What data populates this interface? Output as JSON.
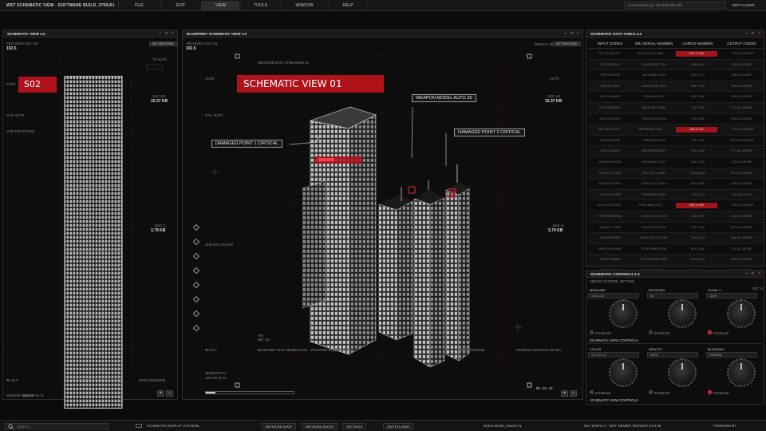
{
  "app": {
    "title": "WST SCHEMATIC VIEW - SOFTWARE BUILD_3765/A1",
    "menu": [
      "FILE",
      "EDIT",
      "VIEW",
      "TOOLS",
      "WINDOW",
      "HELP"
    ],
    "active_menu": "VIEW",
    "ip_field": "Connected to Ip: 192.168.100.225",
    "user": "WST 5 USER"
  },
  "left_panel": {
    "title": "SCHEMATIC VIEW 2.0",
    "archive_label": "ARCHIVED LOG 101",
    "archive_value": "102.5",
    "tag": "S02",
    "side_labels": [
      "AUTO",
      "SYS. AUTO",
      "SUB SYS STATUS",
      "6E-10 #",
      "SENSOR POWER"
    ],
    "right_labels": [
      "TX AUTO",
      "SSC 101",
      "15.37 KB",
      "MAC-C",
      "3.79 KB"
    ],
    "btn": "SET RESTORE",
    "footer": [
      "SENSOR P-H",
      "185 275 33 71",
      "DATE 00/10/2026"
    ]
  },
  "center_panel": {
    "title": "BLUEPRINT SCHEMATIC VIEW 1.0",
    "archive_label": "ARCHIVED LOG 101",
    "archive_value": "102.5",
    "top_label": "MEASURE DATA STREAMING 01",
    "display_btn": "DISPLAY SET",
    "restore_btn": "SET RESTORE",
    "heading": "SCHEMATIC VIEW 01",
    "callouts": [
      "DAMAGED POINT 1 CRITICAL",
      "WEAPON MODEL AUTO 35",
      "DAMAGED POINT 2 CRITICAL"
    ],
    "labels_left": [
      "AUTO",
      "SYS. AUTO",
      "SUB SYS STATUS",
      "6E-10 #",
      "SENSOR P-H",
      "185 275 33 71"
    ],
    "labels_right": [
      "AUTO",
      "SSC 141",
      "15.37 KB",
      "MAC-C",
      "3.79 KB"
    ],
    "footer_text": "BLUEPRINT MAP GENERATION... PROCESS STOPPED AT 22",
    "dates": [
      "DATE 00/10/2026",
      "REFRESH INTERVAL 00 SEC"
    ],
    "timecode": "00 : 10 : 21",
    "fst": "FST",
    "fst_val": "INIT. 02"
  },
  "table_panel": {
    "title": "SCHEMATIC DATA TABLE 1.0",
    "columns": [
      "INPUT CODES",
      "OBJ SERIAL NUMBER",
      "CARGO NUMBER",
      "OUTPUT CODES"
    ],
    "rows": [
      [
        "ТТЯ-70-2557C0",
        "WSLP-NCTO-0988",
        "224-O-984",
        "300-UO-0380W"
      ],
      [
        "S22-GO-5648",
        "ULVR-9230-7789",
        "238-6-483",
        "300-UO-R038T"
      ],
      [
        "ОРР-53-3870P",
        "WL52-8851-2345",
        "350-V-379",
        "460-UO-8380T"
      ],
      [
        "ЭЯК-35-2755Т",
        "L3829-OS8P-4524",
        "523-Y-933",
        "200-UO-0S8PR"
      ],
      [
        "399-TO-M6083",
        "LZ98-HLR-9750",
        "630-Y-936",
        "399-UO-QO0RT"
      ],
      [
        "ТПУ-08-3G/88О",
        "8R9M-3G/1-8769",
        "734-F-932",
        "777-UO-8388W"
      ],
      [
        "ЖЭЗ-09-4000O",
        "РЗ91-ВО76-4378",
        "779-9-940",
        "300-UO-3G87R"
      ],
      [
        "53P-08-6730PP",
        "9ВОЯ-ВО65-7500",
        "350-6-123",
        "370-UO-6038W"
      ],
      [
        "244-00-RAТ6Р",
        "НЕ38-9100-МIL3",
        "730-7-366",
        "74Н-UO-9H32OR"
      ],
      [
        "300-JO-4BА/8",
        "4ВЛЯ-ВЯ08-6037",
        "232-J-038",
        "377-UO-8300W"
      ],
      [
        "298-R2-AV0ОЯ2",
        "9653-20GO-7Q27",
        "283-2-923",
        "303-UO-8O3R"
      ],
      [
        "ТО6-RG-2279ZR",
        "РЕ2Т-8Р73-6059",
        "239-Q-863",
        "3R7-UO-8930W"
      ],
      [
        "МНН-ZR-ТАF07",
        "РО9С-ОЗ77-6414",
        "632-8-390",
        "330-UO-8393R"
      ],
      [
        "ЭЭУ-Э0-А7ЯЯ8",
        "РН09-Р932-4039",
        "772-Y-913",
        "344-UO-8Y9TI"
      ],
      [
        "ЧОН-О4-ЛТ2098",
        "РЕЯН-8А00-0379",
        "233-O-289",
        "353-UO-9AЯОS"
      ],
      [
        "ЯЯТ-ВИ-ЖЯЯ58",
        "СО9Н6-4039-0376",
        "218-9-296",
        "233-UO-9B398R"
      ],
      [
        "ЭОЖ-07-7С89Н",
        "20АЯ-ЭН93-3928",
        "710-F-396",
        "377-UO-9CBOR"
      ],
      [
        "793-Ф3-3ЯЯЯ0",
        "ВЭЭС-ЭРЭЭ-7С88",
        "746-Q-203",
        "308-UO-8Е9ОЯ"
      ],
      [
        "МЗН-СО-ЗФ9ВЕ",
        "ЗТОЕ-НВ9Э-2ЗЯ9",
        "873-J-883",
        "374-UO-3С2ВR"
      ],
      [
        "766-RE-ЯЯВ9В",
        "ЗЭЭС-ВЯЗЯ-А4ВЭ",
        "323-Q-990",
        "33В-UO-ВЕЗ4Т"
      ],
      [
        "ЭЭ7-ТА-Е32ТС",
        "ТЕТН-0233-Е202",
        "528-Q-940",
        "227-UO-В6ЭЭЗ"
      ],
      [
        "ЭЭЭ-ЗЕ-МАЕЭЭЕ",
        "ТОЕЕ-ТОНА-9РОТ",
        "507-A-340",
        "307-UO-ЭЗАЭЗL"
      ]
    ],
    "highlight_rows": [
      0,
      7,
      14
    ]
  },
  "controls_panel": {
    "title": "SCHEMATIC CONTROLS 1.0",
    "subtitle": "SMOKE CONTROL SETTING",
    "row1": [
      {
        "label": "MEASURE",
        "value": "1.00 1.00"
      },
      {
        "label": "ROTATION",
        "value": "0.0"
      },
      {
        "label": "ZOOM +/-",
        "value": "100%"
      }
    ],
    "row1_footer": "SCHEMATIC VIEW CONTROLS",
    "row2": [
      {
        "label": "COLOR",
        "value": "1.0 1.0 1.0"
      },
      {
        "label": "OPACITY",
        "value": "100%"
      },
      {
        "label": "BLENDING",
        "value": "NORMAL"
      }
    ],
    "row2_footer": "SCHEMATIC VIEW CONTROLS",
    "radio_labels": [
      "ENABLED",
      "ENABLED",
      "ENABLED"
    ],
    "set_label": "SET 14"
  },
  "bottom": {
    "search_placeholder": "SEARCH",
    "systems": "SCHEMATIC DISPLAY SYSTEMS",
    "buttons": [
      "NETWORK DHCP",
      "NETWORK ENCRY",
      "SETTINGS",
      "SWITCH USER"
    ],
    "build": "BUILD 55440_54546 /A1",
    "version": "WLT DISPLAY - WST VIEWER VERSION 2.5.2 /M",
    "powered": "POWERED BY"
  },
  "colors": {
    "accent_red": "#b0121a",
    "background": "#0b0b0c",
    "panel": "#0d0d0e"
  }
}
